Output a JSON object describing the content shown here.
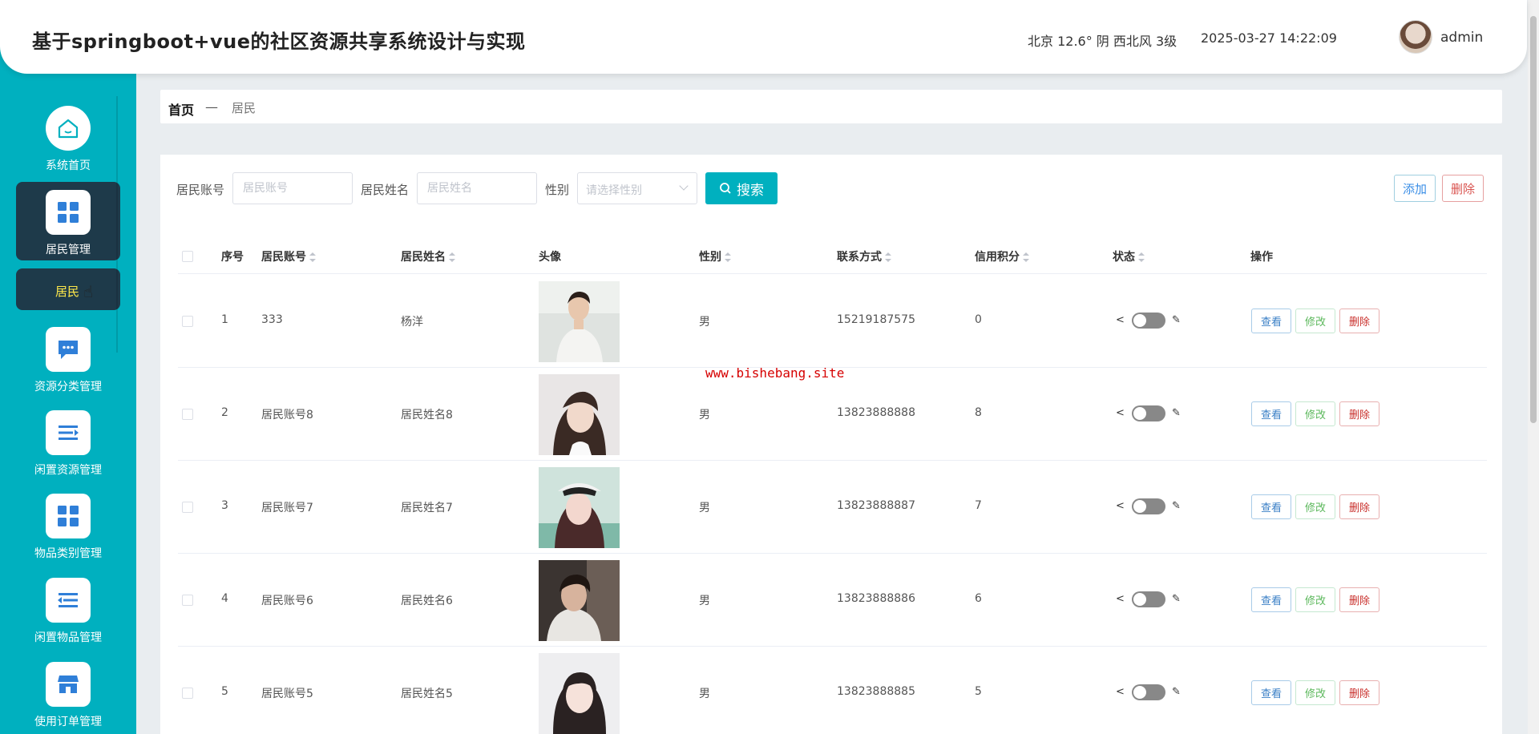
{
  "header": {
    "title": "基于springboot+vue的社区资源共享系统设计与实现",
    "weather": "北京  12.6°  阴  西北风  3级",
    "datetime": "2025-03-27 14:22:09",
    "username": "admin"
  },
  "sidebar": {
    "items": [
      {
        "label": "系统首页",
        "icon": "home-icon"
      },
      {
        "label": "居民管理",
        "icon": "grid-icon"
      },
      {
        "label": "资源分类管理",
        "icon": "chat-icon"
      },
      {
        "label": "闲置资源管理",
        "icon": "list-icon"
      },
      {
        "label": "物品类别管理",
        "icon": "grid-icon"
      },
      {
        "label": "闲置物品管理",
        "icon": "list-icon"
      },
      {
        "label": "使用订单管理",
        "icon": "shop-icon"
      }
    ],
    "sub_item": "居民"
  },
  "breadcrumb": {
    "home": "首页",
    "sep": "—",
    "current": "居民"
  },
  "search": {
    "account_label": "居民账号",
    "account_placeholder": "居民账号",
    "name_label": "居民姓名",
    "name_placeholder": "居民姓名",
    "gender_label": "性别",
    "gender_placeholder": "请选择性别",
    "search_button": "搜索"
  },
  "actions": {
    "add": "添加",
    "delete": "删除"
  },
  "table": {
    "headers": {
      "index": "序号",
      "account": "居民账号",
      "name": "居民姓名",
      "avatar": "头像",
      "gender": "性别",
      "phone": "联系方式",
      "credit": "信用积分",
      "status": "状态",
      "ops": "操作"
    },
    "rows": [
      {
        "index": "1",
        "account": "333",
        "name": "杨洋",
        "gender": "男",
        "phone": "15219187575",
        "credit": "0"
      },
      {
        "index": "2",
        "account": "居民账号8",
        "name": "居民姓名8",
        "gender": "男",
        "phone": "13823888888",
        "credit": "8"
      },
      {
        "index": "3",
        "account": "居民账号7",
        "name": "居民姓名7",
        "gender": "男",
        "phone": "13823888887",
        "credit": "7"
      },
      {
        "index": "4",
        "account": "居民账号6",
        "name": "居民姓名6",
        "gender": "男",
        "phone": "13823888886",
        "credit": "6"
      },
      {
        "index": "5",
        "account": "居民账号5",
        "name": "居民姓名5",
        "gender": "男",
        "phone": "13823888885",
        "credit": "5"
      }
    ],
    "row_actions": {
      "view": "查看",
      "edit": "修改",
      "delete": "删除"
    }
  },
  "watermark": "www.bishebang.site"
}
